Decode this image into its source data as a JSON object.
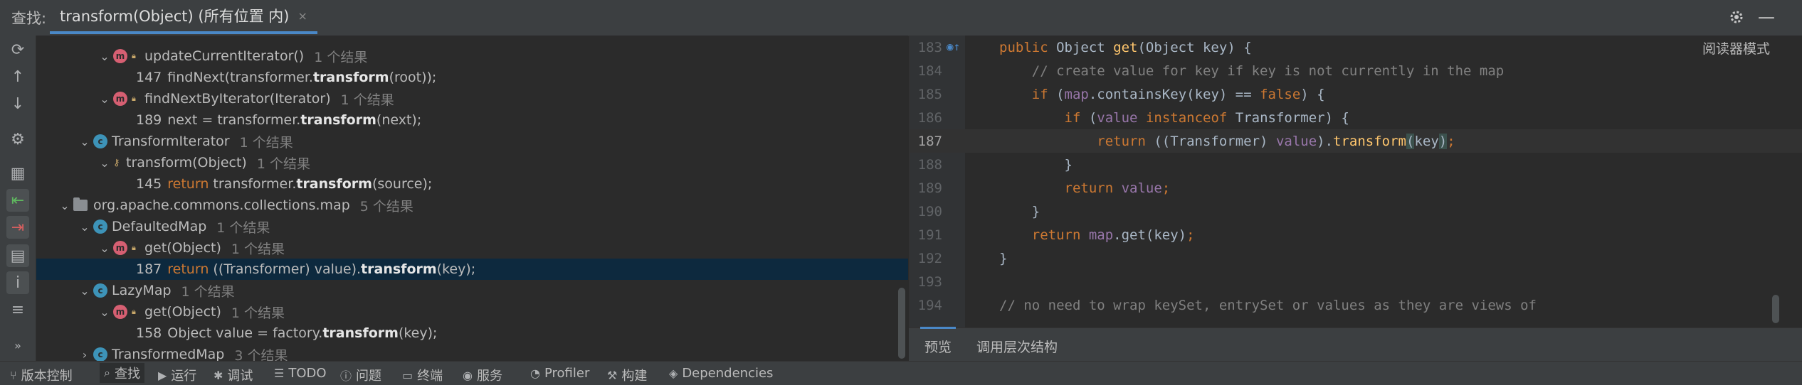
{
  "tabbar": {
    "find_label": "查找:",
    "tab_label": "transform(Object) (所有位置 内)",
    "close_glyph": "×"
  },
  "toolbar_icons": [
    "refresh-icon",
    "arrow-up-icon",
    "arrow-down-icon",
    "settings-icon",
    "group-icon",
    "navigate-in-icon",
    "navigate-out-icon",
    "folder-icon",
    "info-icon",
    "expand-icon"
  ],
  "tree": {
    "rows": [
      {
        "indent": 3,
        "chevron": "⌄",
        "badge": "m",
        "name": "updateCurrentIterator()",
        "count": "1 个结果"
      },
      {
        "indent": 5,
        "lno": "147",
        "pre": "findNext(transformer.",
        "bold": "transform",
        "post": "(root));"
      },
      {
        "indent": 3,
        "chevron": "⌄",
        "badge": "m",
        "name": "findNextByIterator(Iterator)",
        "count": "1 个结果"
      },
      {
        "indent": 5,
        "lno": "189",
        "pre": "next = transformer.",
        "bold": "transform",
        "post": "(next);"
      },
      {
        "indent": 2,
        "chevron": "⌄",
        "badge": "c",
        "name": "TransformIterator",
        "count": "1 个结果"
      },
      {
        "indent": 3,
        "chevron": "⌄",
        "badge": "none",
        "name": "transform(Object)",
        "count": "1 个结果"
      },
      {
        "indent": 5,
        "lno": "145",
        "kw": "return",
        "pre": " transformer.",
        "bold": "transform",
        "post": "(source);"
      },
      {
        "indent": 1,
        "chevron": "⌄",
        "badge": "pkg",
        "name": "org.apache.commons.collections.map",
        "count": "5 个结果"
      },
      {
        "indent": 2,
        "chevron": "⌄",
        "badge": "c",
        "name": "DefaultedMap",
        "count": "1 个结果"
      },
      {
        "indent": 3,
        "chevron": "⌄",
        "badge": "m",
        "name": "get(Object)",
        "count": "1 个结果"
      },
      {
        "indent": 5,
        "lno": "187",
        "kw": "return",
        "pre": " ((Transformer) value).",
        "bold": "transform",
        "post": "(key);",
        "selected": true
      },
      {
        "indent": 2,
        "chevron": "⌄",
        "badge": "c",
        "name": "LazyMap",
        "count": "1 个结果"
      },
      {
        "indent": 3,
        "chevron": "⌄",
        "badge": "m",
        "name": "get(Object)",
        "count": "1 个结果"
      },
      {
        "indent": 5,
        "lno": "158",
        "pre": "Object value = factory.",
        "bold": "transform",
        "post": "(key);"
      },
      {
        "indent": 2,
        "chevron": "›",
        "badge": "c",
        "name": "TransformedMap",
        "count": "3 个结果"
      }
    ]
  },
  "editor": {
    "reader_mode": "阅读器模式",
    "lines": [
      {
        "n": "183",
        "tokens": [
          [
            "kw",
            "public "
          ],
          [
            "par",
            "Object "
          ],
          [
            "fn",
            "get"
          ],
          [
            "par",
            "(Object key) {"
          ]
        ]
      },
      {
        "n": "184",
        "tokens": [
          [
            "cm",
            "    // create value for key if key is not currently in the map"
          ]
        ]
      },
      {
        "n": "185",
        "tokens": [
          [
            "kw",
            "    if "
          ],
          [
            "par",
            "("
          ],
          [
            "fld",
            "map"
          ],
          [
            "par",
            ".containsKey(key) == "
          ],
          [
            "kw",
            "false"
          ],
          [
            "par",
            ") {"
          ]
        ]
      },
      {
        "n": "186",
        "tokens": [
          [
            "kw",
            "        if "
          ],
          [
            "par",
            "("
          ],
          [
            "fld",
            "value "
          ],
          [
            "kw",
            "instanceof "
          ],
          [
            "par",
            "Transformer) {"
          ]
        ]
      },
      {
        "n": "187",
        "tokens": [
          [
            "kw",
            "            return "
          ],
          [
            "par",
            "((Transformer) "
          ],
          [
            "fld",
            "value"
          ],
          [
            "par",
            ")."
          ],
          [
            "fn",
            "transform"
          ],
          [
            "hl",
            "("
          ],
          [
            "par",
            "key"
          ],
          [
            "hl",
            ")"
          ],
          [
            "kw",
            ";"
          ]
        ],
        "current": true
      },
      {
        "n": "188",
        "tokens": [
          [
            "par",
            "        }"
          ]
        ]
      },
      {
        "n": "189",
        "tokens": [
          [
            "kw",
            "        return "
          ],
          [
            "fld",
            "value"
          ],
          [
            "kw",
            ";"
          ]
        ]
      },
      {
        "n": "190",
        "tokens": [
          [
            "par",
            "    }"
          ]
        ]
      },
      {
        "n": "191",
        "tokens": [
          [
            "kw",
            "    return "
          ],
          [
            "fld",
            "map"
          ],
          [
            "par",
            ".get(key)"
          ],
          [
            "kw",
            ";"
          ]
        ]
      },
      {
        "n": "192",
        "tokens": [
          [
            "par",
            "}"
          ]
        ]
      },
      {
        "n": "193",
        "tokens": []
      },
      {
        "n": "194",
        "tokens": [
          [
            "cm",
            "// no need to wrap keySet, entrySet or values as they are views of"
          ]
        ]
      }
    ],
    "tabs": [
      "预览",
      "调用层次结构"
    ]
  },
  "status": {
    "items": [
      {
        "icon": "branch-icon",
        "glyph": "⑂",
        "label": "版本控制"
      },
      {
        "icon": "search-icon",
        "glyph": "⌕",
        "label": "查找",
        "active": true
      },
      {
        "icon": "run-icon",
        "glyph": "▶",
        "label": "运行"
      },
      {
        "icon": "debug-icon",
        "glyph": "✱",
        "label": "调试"
      },
      {
        "icon": "todo-icon",
        "glyph": "☰",
        "label": "TODO"
      },
      {
        "icon": "problems-icon",
        "glyph": "ⓘ",
        "label": "问题"
      },
      {
        "icon": "terminal-icon",
        "glyph": "▭",
        "label": "终端"
      },
      {
        "icon": "services-icon",
        "glyph": "◉",
        "label": "服务"
      },
      {
        "icon": "profiler-icon",
        "glyph": "◔",
        "label": "Profiler"
      },
      {
        "icon": "build-icon",
        "glyph": "⚒",
        "label": "构建"
      },
      {
        "icon": "dependencies-icon",
        "glyph": "◈",
        "label": "Dependencies"
      }
    ]
  }
}
